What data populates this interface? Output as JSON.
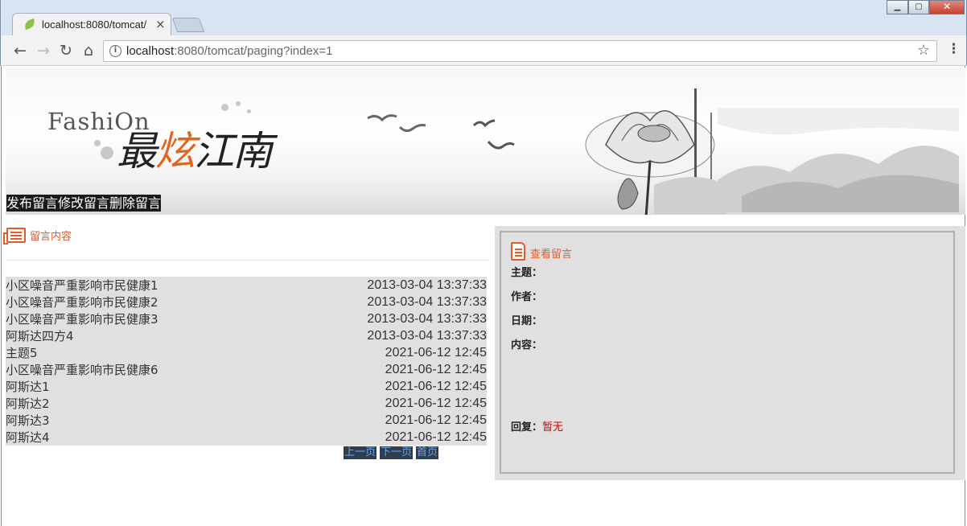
{
  "browser": {
    "tab_title": "localhost:8080/tomcat/",
    "tab_close": "×",
    "url_host": "localhost",
    "url_rest": ":8080/tomcat/paging?index=1",
    "back_icon": "arrow-left-icon",
    "forward_icon": "arrow-right-icon",
    "reload_icon": "reload-icon",
    "home_icon": "home-icon",
    "bookmark_icon": "star-icon",
    "menu_icon": "more-vert-icon"
  },
  "banner": {
    "logo_text": "FashiOn",
    "logo_cn_1": "最",
    "logo_cn_2": "炫",
    "logo_cn_3": "江南"
  },
  "nav": {
    "items": [
      "发布留言",
      "修改留言",
      "删除留言"
    ]
  },
  "messages": {
    "section_title": "留言内容",
    "rows": [
      {
        "title": "小区噪音严重影响市民健康1",
        "date": "2013-03-04 13:37:33"
      },
      {
        "title": "小区噪音严重影响市民健康2",
        "date": "2013-03-04 13:37:33"
      },
      {
        "title": "小区噪音严重影响市民健康3",
        "date": "2013-03-04 13:37:33"
      },
      {
        "title": "阿斯达四方4",
        "date": "2013-03-04 13:37:33"
      },
      {
        "title": "主题5",
        "date": "2021-06-12 12:45"
      },
      {
        "title": "小区噪音严重影响市民健康6",
        "date": "2021-06-12 12:45"
      },
      {
        "title": "阿斯达1",
        "date": "2021-06-12 12:45"
      },
      {
        "title": "阿斯达2",
        "date": "2021-06-12 12:45"
      },
      {
        "title": "阿斯达3",
        "date": "2021-06-12 12:45"
      },
      {
        "title": "阿斯达4",
        "date": "2021-06-12 12:45"
      }
    ],
    "pager": {
      "prev": "上一页",
      "next": "下一页",
      "first": "首页"
    }
  },
  "detail": {
    "title": "查看留言",
    "subject_label": "主题：",
    "author_label": "作者：",
    "date_label": "日期：",
    "content_label": "内容：",
    "reply_label": "回复：",
    "reply_value": "暂无"
  },
  "colors": {
    "accent": "#e55a2b",
    "reply": "#d40000",
    "list_bg": "#e0e0e0",
    "nav_bg": "#1a1a1a",
    "pager_bg": "#2f3e4e",
    "pager_text": "#6aa5ef"
  }
}
